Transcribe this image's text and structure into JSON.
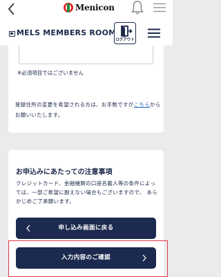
{
  "topbar": {
    "brand": "Menicon",
    "back_icon": "chevron-left-icon",
    "notification_icon": "bell-icon",
    "menu_icon": "hamburger-icon"
  },
  "header": {
    "title": "MELS MEMBERS ROOM",
    "logout_label": "ログアウト",
    "logout_icon": "logout-door-icon",
    "menu_icon": "hamburger-icon"
  },
  "form": {
    "input_value": "",
    "required_note": "※必須項目ではございません",
    "address_note_before": "登録住所の変更を希望される方は、お手数ですが",
    "address_note_link": "こちら",
    "address_note_after": "からお願いいたします。"
  },
  "caution": {
    "title": "お申込みにあたっての注意事項",
    "body": "クレジットカード、金融機関の口座名義人等の条件によっては、一部ご希望に副えない場合もございますので、 あらかじめご了承願います。"
  },
  "buttons": {
    "back_label": "申し込み画面に戻る",
    "confirm_label": "入力内容のご確認"
  },
  "colors": {
    "navy": "#1b2a4e",
    "link": "#2f6dc2",
    "highlight": "#e0364a",
    "brand_red": "#e2202a"
  }
}
